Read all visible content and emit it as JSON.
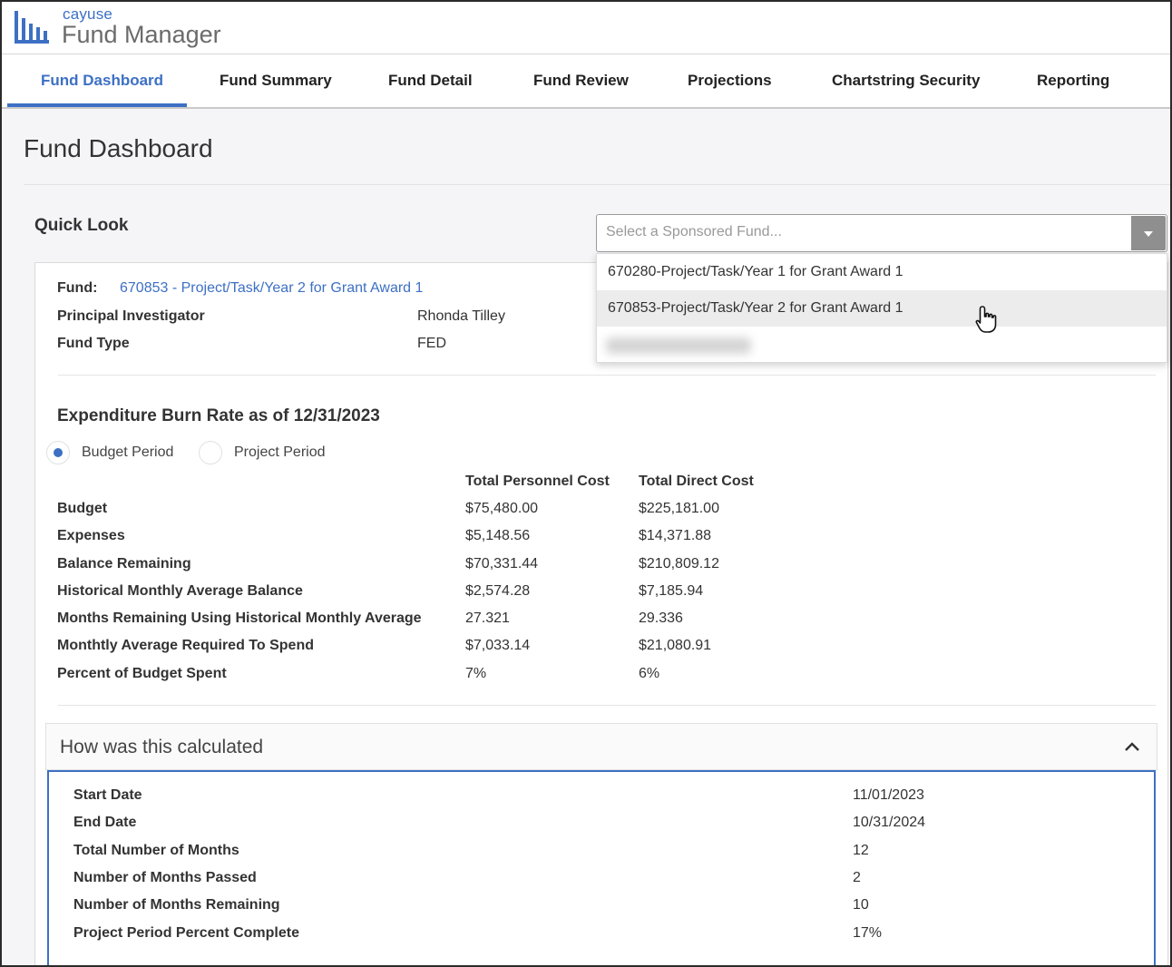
{
  "brand": {
    "small": "cayuse",
    "main": "Fund Manager"
  },
  "nav": {
    "items": [
      {
        "label": "Fund Dashboard"
      },
      {
        "label": "Fund Summary"
      },
      {
        "label": "Fund Detail"
      },
      {
        "label": "Fund Review"
      },
      {
        "label": "Projections"
      },
      {
        "label": "Chartstring Security"
      },
      {
        "label": "Reporting"
      }
    ],
    "active_index": 0
  },
  "page_title": "Fund Dashboard",
  "quick_look": {
    "label": "Quick Look",
    "select_placeholder": "Select a Sponsored Fund...",
    "options": [
      "670280-Project/Task/Year 1 for Grant Award 1",
      "670853-Project/Task/Year 2 for Grant Award 1"
    ],
    "hovered_option_index": 1
  },
  "fund_info": {
    "fund_label": "Fund:",
    "fund_value": "670853 - Project/Task/Year 2 for Grant Award 1",
    "pi_label": "Principal Investigator",
    "pi_value": "Rhonda Tilley",
    "type_label": "Fund Type",
    "type_value": "FED"
  },
  "burn_rate": {
    "title": "Expenditure Burn Rate as of 12/31/2023",
    "radio_budget": "Budget Period",
    "radio_project": "Project Period",
    "selected": "Budget Period",
    "col_personnel": "Total Personnel Cost",
    "col_direct": "Total Direct Cost",
    "rows": [
      {
        "label": "Budget",
        "personnel": "$75,480.00",
        "direct": "$225,181.00"
      },
      {
        "label": "Expenses",
        "personnel": "$5,148.56",
        "direct": "$14,371.88"
      },
      {
        "label": "Balance Remaining",
        "personnel": "$70,331.44",
        "direct": "$210,809.12"
      },
      {
        "label": "Historical Monthly Average Balance",
        "personnel": "$2,574.28",
        "direct": "$7,185.94"
      },
      {
        "label": "Months Remaining Using Historical Monthly Average",
        "personnel": "27.321",
        "direct": "29.336"
      },
      {
        "label": "Monthtly Average Required To Spend",
        "personnel": "$7,033.14",
        "direct": "$21,080.91"
      },
      {
        "label": "Percent of Budget Spent",
        "personnel": "7%",
        "direct": "6%"
      }
    ]
  },
  "calculation": {
    "title": "How was this calculated",
    "rows": [
      {
        "label": "Start Date",
        "value": "11/01/2023"
      },
      {
        "label": "End Date",
        "value": "10/31/2024"
      },
      {
        "label": "Total Number of Months",
        "value": "12"
      },
      {
        "label": "Number of Months Passed",
        "value": "2"
      },
      {
        "label": "Number of Months Remaining",
        "value": "10"
      },
      {
        "label": "Project Period Percent Complete",
        "value": "17%"
      }
    ]
  },
  "colors": {
    "accent": "#3d70c4",
    "caret_bg": "#8f8f8f",
    "hover_row": "#ececec"
  },
  "icons": {
    "logo": "bar-chart-logo-icon",
    "caret": "chevron-down-icon",
    "collapse": "chevron-up-icon",
    "cursor": "hand-pointer-icon"
  }
}
